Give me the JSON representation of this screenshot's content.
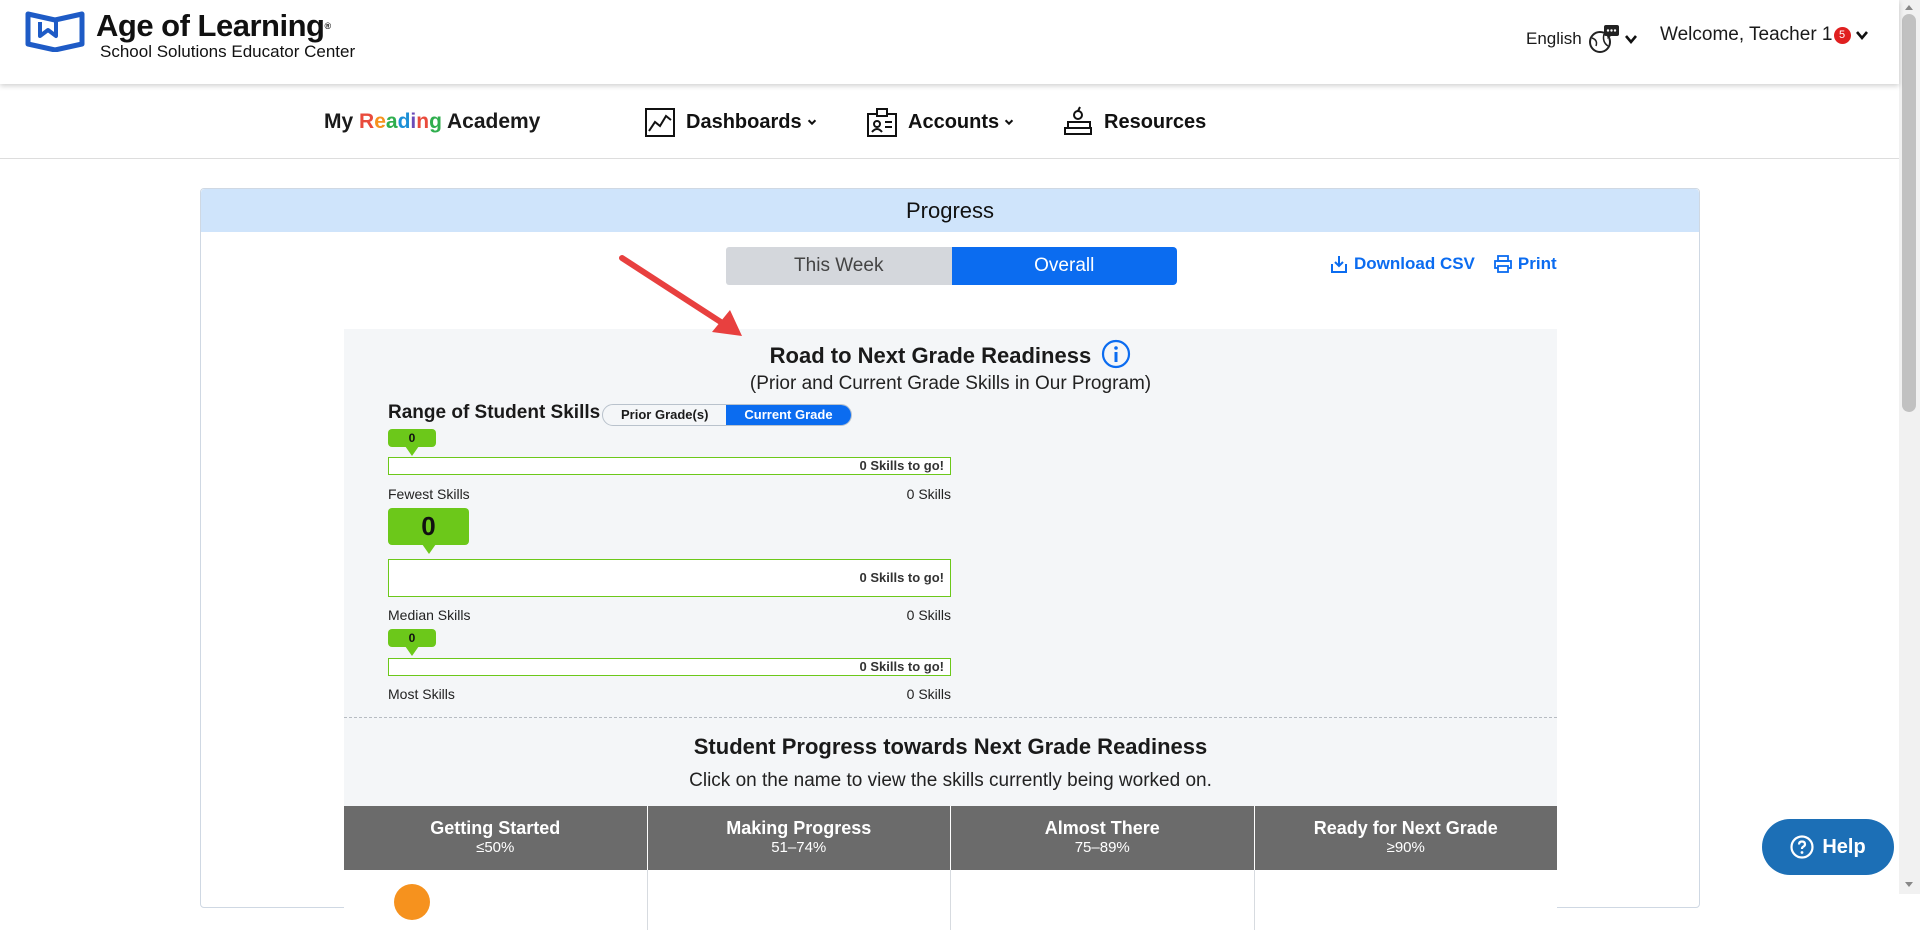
{
  "header": {
    "logo_title": "Age of Learning",
    "logo_mark": "®",
    "logo_subtitle": "School Solutions Educator Center",
    "language": "English",
    "welcome": "Welcome, Teacher 1",
    "notification_count": "5"
  },
  "nav": {
    "brand": {
      "my": "My",
      "reading": [
        "R",
        "e",
        "a",
        "d",
        "i",
        "n",
        "g"
      ],
      "academy": "Academy"
    },
    "items": [
      {
        "label": "Dashboards",
        "icon": "chart-icon",
        "has_dropdown": true
      },
      {
        "label": "Accounts",
        "icon": "id-card-icon",
        "has_dropdown": true
      },
      {
        "label": "Resources",
        "icon": "books-icon",
        "has_dropdown": false
      }
    ]
  },
  "panel": {
    "title": "Progress",
    "tabs": {
      "week": "This Week",
      "overall": "Overall",
      "active": "overall"
    },
    "download_csv": "Download CSV",
    "print": "Print"
  },
  "road": {
    "title": "Road to Next Grade Readiness",
    "subtitle": "(Prior and Current Grade Skills in Our Program)",
    "range_label": "Range of Student Skills",
    "segment": {
      "prior": "Prior Grade(s)",
      "current": "Current Grade",
      "active": "current"
    },
    "rows": [
      {
        "bubble": "0",
        "bar_text": "0 Skills to go!",
        "label": "Fewest Skills",
        "value": "0 Skills"
      },
      {
        "bubble": "0",
        "bar_text": "0 Skills to go!",
        "label": "Median Skills",
        "value": "0 Skills"
      },
      {
        "bubble": "0",
        "bar_text": "0 Skills to go!",
        "label": "Most Skills",
        "value": "0 Skills"
      }
    ]
  },
  "student_progress": {
    "title": "Student Progress towards Next Grade Readiness",
    "subtitle": "Click on the name to view the skills currently being worked on.",
    "columns": [
      {
        "title": "Getting Started",
        "range": "≤50%"
      },
      {
        "title": "Making Progress",
        "range": "51–74%"
      },
      {
        "title": "Almost There",
        "range": "75–89%"
      },
      {
        "title": "Ready for Next Grade",
        "range": "≥90%"
      }
    ]
  },
  "help": {
    "label": "Help"
  },
  "colors": {
    "accent": "#0b6cf0",
    "panel_header": "#cfe4fb",
    "progress_green": "#6cc81a",
    "column_header": "#6b6b6b",
    "help": "#1c6fb6",
    "annotation_arrow": "#e8403f",
    "reading_letters": [
      "#e94b3c",
      "#f6921e",
      "#2fae4e",
      "#1b8fd6",
      "#6b4bb8",
      "#e94b3c",
      "#2fae4e"
    ]
  }
}
